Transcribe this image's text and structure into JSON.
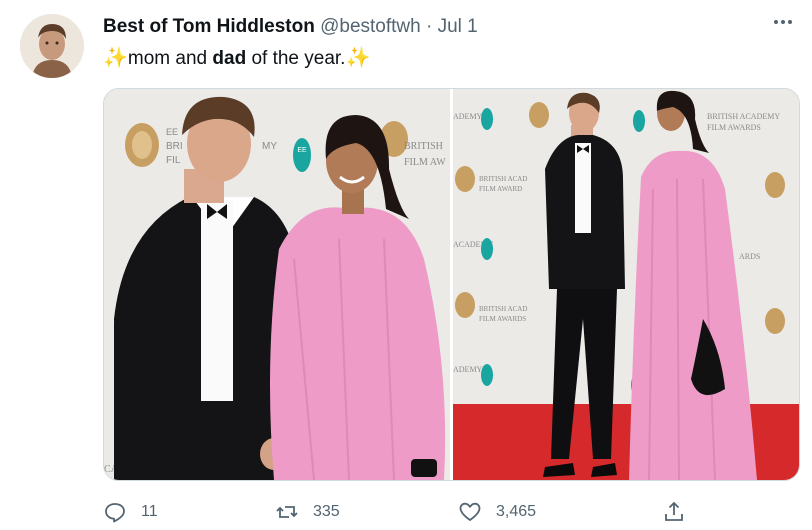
{
  "tweet": {
    "author_name": "Best of Tom Hiddleston",
    "handle": "@bestoftwh",
    "separator": "·",
    "date": "Jul 1",
    "text_before": "mom and ",
    "text_bold": "dad",
    "text_after": " of the year.",
    "emoji_left": "✨",
    "emoji_right": "✨"
  },
  "actions": {
    "replies": "11",
    "retweets": "335",
    "likes": "3,465"
  },
  "backdrop_text": {
    "left_1": "EE",
    "left_2": "BRI",
    "left_3": "FIL",
    "left_4": "MY",
    "left_5": "BRITISH",
    "left_6": "FILM AW",
    "left_7": "CAD",
    "right_1": "ADEMY",
    "right_2": "BRITISH ACADEMY",
    "right_3": "FILM AWARDS",
    "right_4": "BRITISH ACAD",
    "right_5": "FILM AWARD",
    "right_6": "ACADEMY",
    "right_7": "ARDS",
    "right_8": "BRITISH ACAD",
    "right_9": "FILM AWARDS",
    "right_10": "ADEMY"
  },
  "colors": {
    "accent_pink": "#ef9bc7",
    "velvet": "#141416",
    "backdrop": "#eceae7",
    "carpet": "#d6292b",
    "gold": "#c89f63",
    "ee_teal": "#1aa6a0"
  },
  "icons": [
    "more-options-icon",
    "reply-icon",
    "retweet-icon",
    "like-icon",
    "share-icon",
    "sparkles-icon"
  ]
}
